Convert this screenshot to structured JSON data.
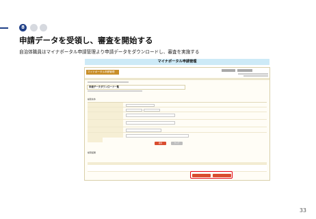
{
  "step": {
    "current": "8"
  },
  "page": {
    "title": "申請データを受領し、審査を開始する",
    "subtitle": "自治体職員はマイナポータル申請管理より申請データをダウンロードし、審査を実施する",
    "band_label": "マイナポータル申請管理",
    "page_number": "33"
  },
  "screenshot": {
    "logo": "マイナポータル申請管理",
    "header_buttons": [
      "",
      ""
    ],
    "screen_title": "申請データダウンロード一覧",
    "section_search": "検索条件",
    "section_results": "検索結果",
    "buttons": {
      "search": "検索",
      "clear": "クリア",
      "download_1": "",
      "download_2": ""
    },
    "colors": {
      "accent": "#d94c2f",
      "highlight": "#e60012",
      "logo": "#c98f2a",
      "step": "#1f3f86"
    }
  }
}
